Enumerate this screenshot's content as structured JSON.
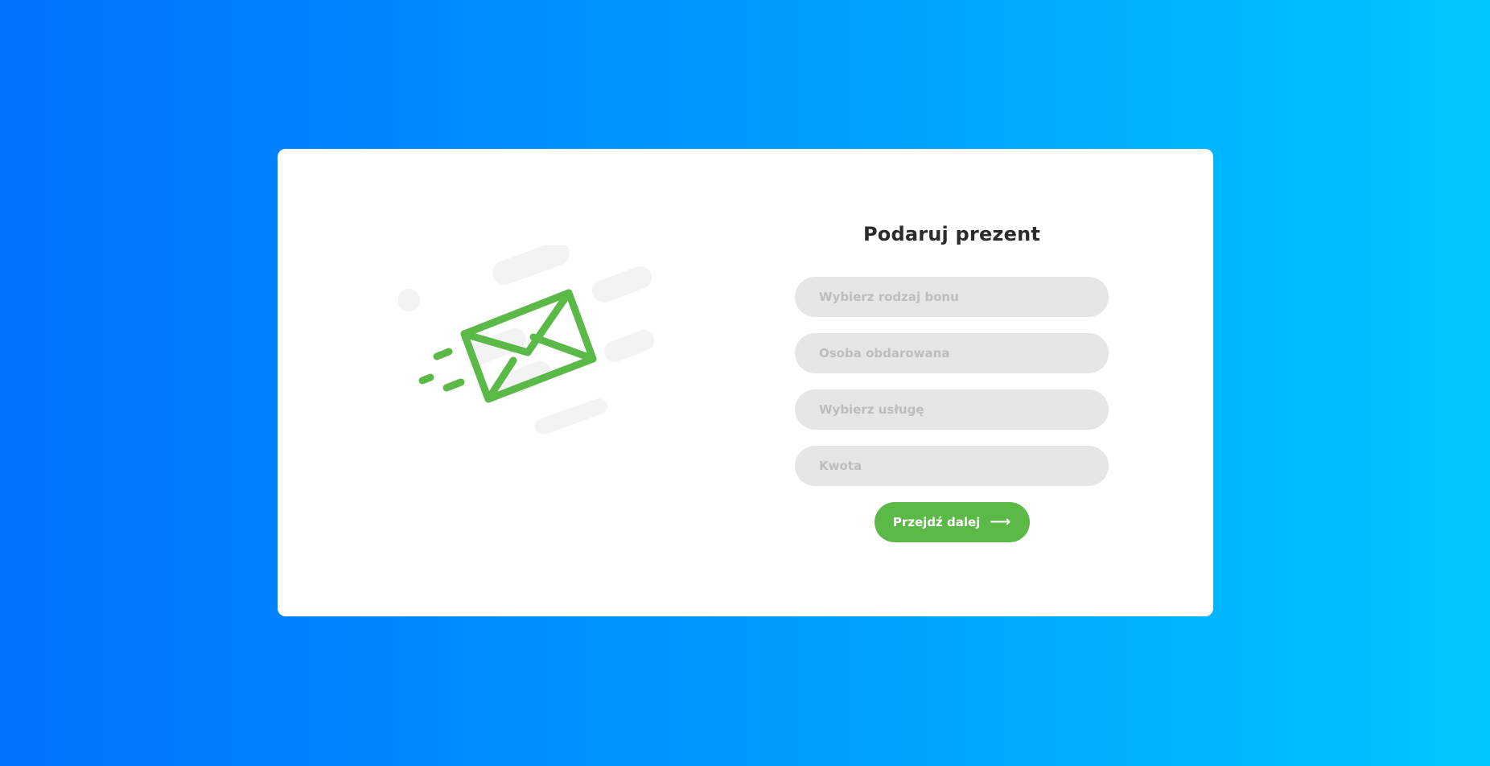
{
  "form": {
    "title": "Podaruj prezent",
    "fields": [
      {
        "placeholder": "Wybierz rodzaj bonu",
        "value": ""
      },
      {
        "placeholder": "Osoba obdarowana",
        "value": ""
      },
      {
        "placeholder": "Wybierz usługę",
        "value": ""
      },
      {
        "placeholder": "Kwota",
        "value": ""
      }
    ],
    "submit_label": "Przejdź dalej",
    "submit_icon": "arrow-right-icon"
  },
  "illustration": {
    "icon": "flying-envelope-icon"
  },
  "colors": {
    "background_start": "#0072ff",
    "background_end": "#00c6ff",
    "accent_green": "#5bb947",
    "field_background": "#e6e6e6",
    "title_text": "#2b2b2b"
  }
}
